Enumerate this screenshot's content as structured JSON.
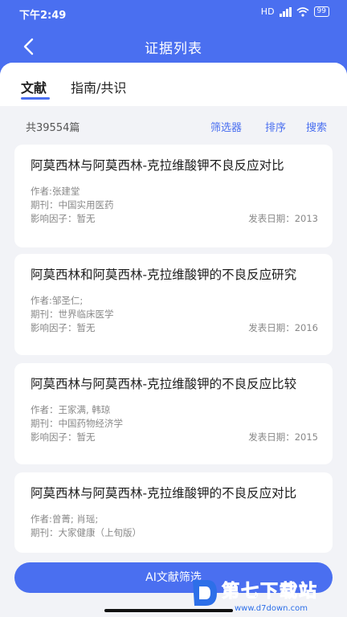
{
  "status": {
    "time": "下午2:49",
    "network": "HD",
    "battery": "99"
  },
  "nav": {
    "title": "证据列表"
  },
  "tabs": [
    {
      "label": "文献"
    },
    {
      "label": "指南/共识"
    }
  ],
  "toolbar": {
    "count": "共39554篇",
    "filter": "筛选器",
    "sort": "排序",
    "search": "搜索"
  },
  "articles": [
    {
      "title": "阿莫西林与阿莫西林-克拉维酸钾不良反应对比",
      "author": "作者:张建堂",
      "journal": "期刊：中国实用医药",
      "impact": "影响因子：暂无",
      "date": "发表日期：2013"
    },
    {
      "title": "阿莫西林和阿莫西林-克拉维酸钾的不良反应研究",
      "author": "作者:邹圣仁;",
      "journal": "期刊：世界临床医学",
      "impact": "影响因子：暂无",
      "date": "发表日期：2016"
    },
    {
      "title": "阿莫西林与阿莫西林-克拉维酸钾的不良反应比较",
      "author": "作者：王家满, 韩琼",
      "journal": "期刊：中国药物经济学",
      "impact": "影响因子：暂无",
      "date": "发表日期：2015"
    },
    {
      "title": "阿莫西林与阿莫西林-克拉维酸钾的不良反应对比",
      "author": "作者:曾菁; 肖瑶;",
      "journal": "期刊：大家健康（上旬版）",
      "impact": "",
      "date": ""
    }
  ],
  "bottom": {
    "button": "AI文献筛选"
  },
  "watermark": {
    "text": "第七下载站",
    "url": "www.d7down.com"
  },
  "colors": {
    "accent": "#4a6ff0",
    "background": "#f2f3f7"
  }
}
